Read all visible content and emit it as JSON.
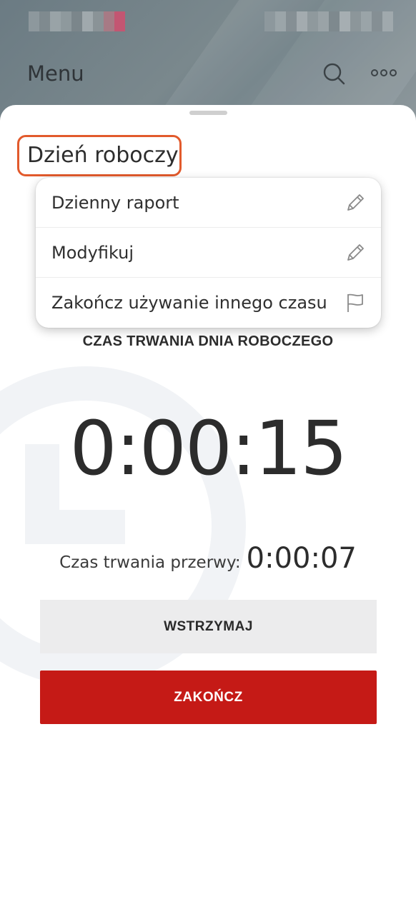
{
  "app": {
    "title": "Menu",
    "icons": [
      "search-icon",
      "more-icon"
    ]
  },
  "sheet": {
    "title": "Dzień roboczy",
    "menu": [
      {
        "label": "Dzienny raport",
        "icon": "pencil-icon"
      },
      {
        "label": "Modyfikuj",
        "icon": "pencil-icon"
      },
      {
        "label": "Zakończ używanie innego czasu",
        "icon": "flag-icon"
      }
    ],
    "duration_label": "CZAS TRWANIA DNIA ROBOCZEGO",
    "timer": "0:00:15",
    "break_label": "Czas trwania przerwy:",
    "break_value": "0:00:07",
    "pause_button": "WSTRZYMAJ",
    "end_button": "ZAKOŃCZ"
  },
  "colors": {
    "highlight": "#e25a2c",
    "primary_red": "#c51a16",
    "secondary_button": "#ececed"
  }
}
